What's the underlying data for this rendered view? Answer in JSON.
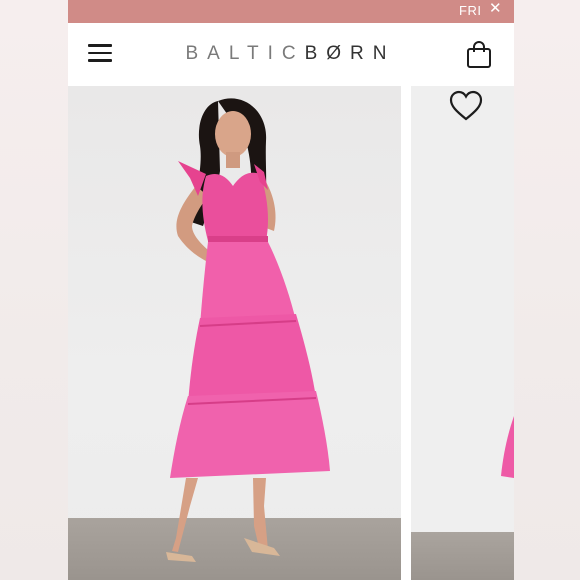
{
  "promo": {
    "text": "FRI",
    "close_icon": "close-icon"
  },
  "header": {
    "brand_part1": "BALTIC",
    "brand_part2": "BØRN",
    "menu_icon": "hamburger-menu-icon",
    "cart_icon": "shopping-bag-icon"
  },
  "product": {
    "wishlist_icon": "heart-outline-icon",
    "main_image": "model in pink tiered tulle midi dress",
    "next_image": "pink tulle dress detail"
  },
  "colors": {
    "promo_bar": "#d08b87",
    "dress_pink": "#ee5aa6",
    "logo_gray": "#7a7a7a",
    "logo_dark": "#333333"
  }
}
